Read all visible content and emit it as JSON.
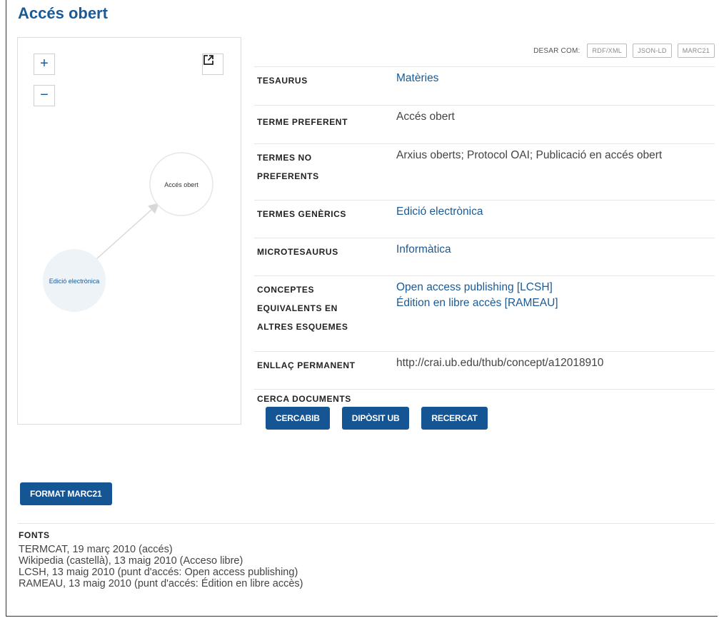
{
  "page": {
    "title": "Accés obert"
  },
  "graph": {
    "zoom_in": "+",
    "zoom_out": "−",
    "expand_icon": "external-link-icon",
    "nodes": [
      {
        "label": "Accés obert"
      },
      {
        "label": "Edició electrònica"
      }
    ]
  },
  "save": {
    "label": "DESAR COM:",
    "formats": [
      "RDF/XML",
      "JSON-LD",
      "MARC21"
    ]
  },
  "props": {
    "tesaurus": {
      "label": "TESAURUS",
      "value": "Matèries"
    },
    "preferent": {
      "label": "TERME PREFERENT",
      "value": "Accés obert"
    },
    "no_preferents": {
      "label_1": "TERMES NO",
      "label_2": "PREFERENTS",
      "value": "Arxius oberts; Protocol OAI; Publicació en accés obert"
    },
    "generics": {
      "label": "TERMES GENÈRICS",
      "value": "Edició electrònica"
    },
    "microtesaurus": {
      "label": "MICROTESAURUS",
      "value": "Informàtica"
    },
    "equivalents": {
      "label_1": "CONCEPTES",
      "label_2": "EQUIVALENTS EN",
      "label_3": "ALTRES ESQUEMES",
      "values": [
        "Open access publishing [LCSH]",
        "Édition en libre accès [RAMEAU]"
      ]
    },
    "permanent": {
      "label": "ENLLAÇ PERMANENT",
      "value": "http://crai.ub.edu/thub/concept/a12018910"
    },
    "cerca": {
      "label": "CERCA DOCUMENTS",
      "buttons": [
        "CERCABIB",
        "DIPÒSIT UB",
        "RECERCAT"
      ]
    }
  },
  "marc_button": "FORMAT MARC21",
  "fonts": {
    "title": "FONTS",
    "items": [
      "TERMCAT, 19 març 2010 (accés)",
      "Wikipedia (castellà), 13 maig 2010 (Acceso libre)",
      "LCSH, 13 maig 2010 (punt d'accés: Open access publishing)",
      "RAMEAU, 13 maig 2010 (punt d'accés: Édition en libre accès)"
    ]
  },
  "colors": {
    "primary": "#155594",
    "title": "#1a5a96",
    "node_fill": "#eef3f8"
  }
}
